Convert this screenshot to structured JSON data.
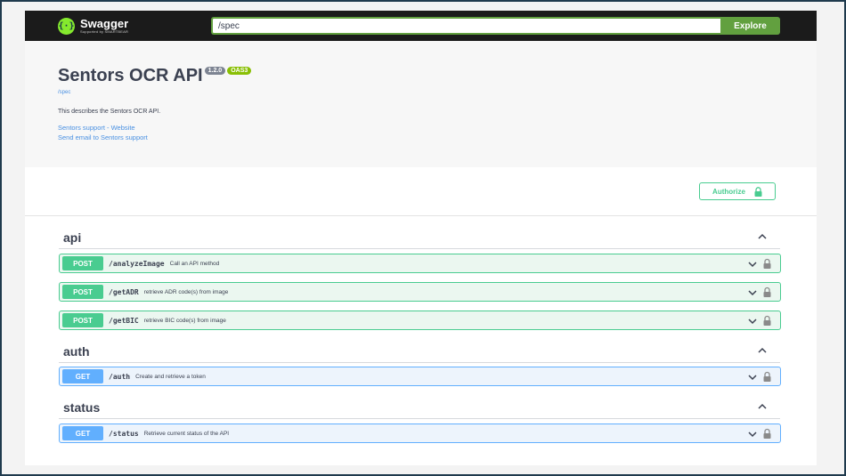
{
  "topbar": {
    "logo_symbol": "{·}",
    "logo_name": "Swagger",
    "logo_sub": "Supported by SMARTBEAR",
    "url_value": "/spec",
    "explore_label": "Explore"
  },
  "info": {
    "title": "Sentors OCR API",
    "version": "1.2.0",
    "oas": "OAS3",
    "spec_link": "/spec",
    "description": "This describes the Sentors OCR API.",
    "links": [
      "Sentors support - Website",
      "Send email to Sentors support"
    ]
  },
  "authorize_label": "Authorize",
  "tags": [
    {
      "name": "api",
      "operations": [
        {
          "method": "POST",
          "path": "/analyzeImage",
          "summary": "Call an API method"
        },
        {
          "method": "POST",
          "path": "/getADR",
          "summary": "retrieve ADR code(s) from image"
        },
        {
          "method": "POST",
          "path": "/getBIC",
          "summary": "retrieve BIC code(s) from image"
        }
      ]
    },
    {
      "name": "auth",
      "operations": [
        {
          "method": "GET",
          "path": "/auth",
          "summary": "Create and retrieve a token"
        }
      ]
    },
    {
      "name": "status",
      "operations": [
        {
          "method": "GET",
          "path": "/status",
          "summary": "Retrieve current status of the API"
        }
      ]
    }
  ],
  "colors": {
    "post": "#49cc90",
    "get": "#61affe",
    "topbar": "#1b1b1b",
    "explore": "#62a03f"
  },
  "icons": [
    "swagger-logo-icon",
    "lock-icon",
    "chevron-up-icon",
    "chevron-down-icon"
  ]
}
